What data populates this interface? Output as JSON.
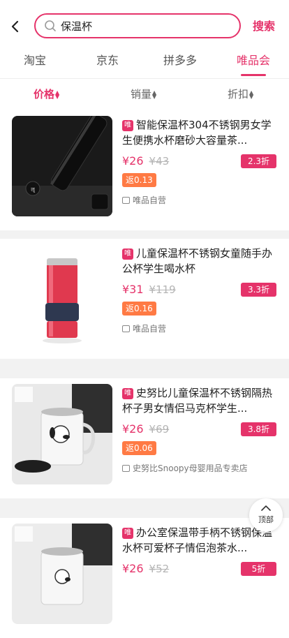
{
  "header": {
    "query": "保温杯",
    "search_label": "搜索"
  },
  "tabs": [
    {
      "label": "淘宝",
      "active": false
    },
    {
      "label": "京东",
      "active": false
    },
    {
      "label": "拼多多",
      "active": false
    },
    {
      "label": "唯品会",
      "active": true
    }
  ],
  "sort": [
    {
      "label": "价格",
      "active": true
    },
    {
      "label": "销量",
      "active": false
    },
    {
      "label": "折扣",
      "active": false
    }
  ],
  "vip_badge": "唯",
  "products": [
    {
      "title": "智能保温杯304不锈钢男女学生便携水杯磨砂大容量茶...",
      "price": "¥26",
      "original_price": "¥43",
      "discount": "2.3折",
      "rebate": "返0.13",
      "shop": "唯品自营",
      "image": "black-thermos-image"
    },
    {
      "title": "儿童保温杯不锈钢女童随手办公杯学生喝水杯",
      "price": "¥31",
      "original_price": "¥119",
      "discount": "3.3折",
      "rebate": "返0.16",
      "shop": "唯品自营",
      "image": "red-thermos-image"
    },
    {
      "title": "史努比儿童保温杯不锈钢隔热杯子男女情侣马克杯学生...",
      "price": "¥26",
      "original_price": "¥69",
      "discount": "3.8折",
      "rebate": "返0.06",
      "shop": "史努比Snoopy母婴用品专卖店",
      "image": "snoopy-mug-image"
    },
    {
      "title": "办公室保温带手柄不锈钢保温水杯可爱杯子情侣泡茶水...",
      "price": "¥26",
      "original_price": "¥52",
      "discount": "5折",
      "rebate": "",
      "shop": "",
      "image": "snoopy-mug-image"
    }
  ],
  "back_to_top": "顶部",
  "colors": {
    "accent": "#e5336a",
    "rebate": "#ff7a44"
  }
}
